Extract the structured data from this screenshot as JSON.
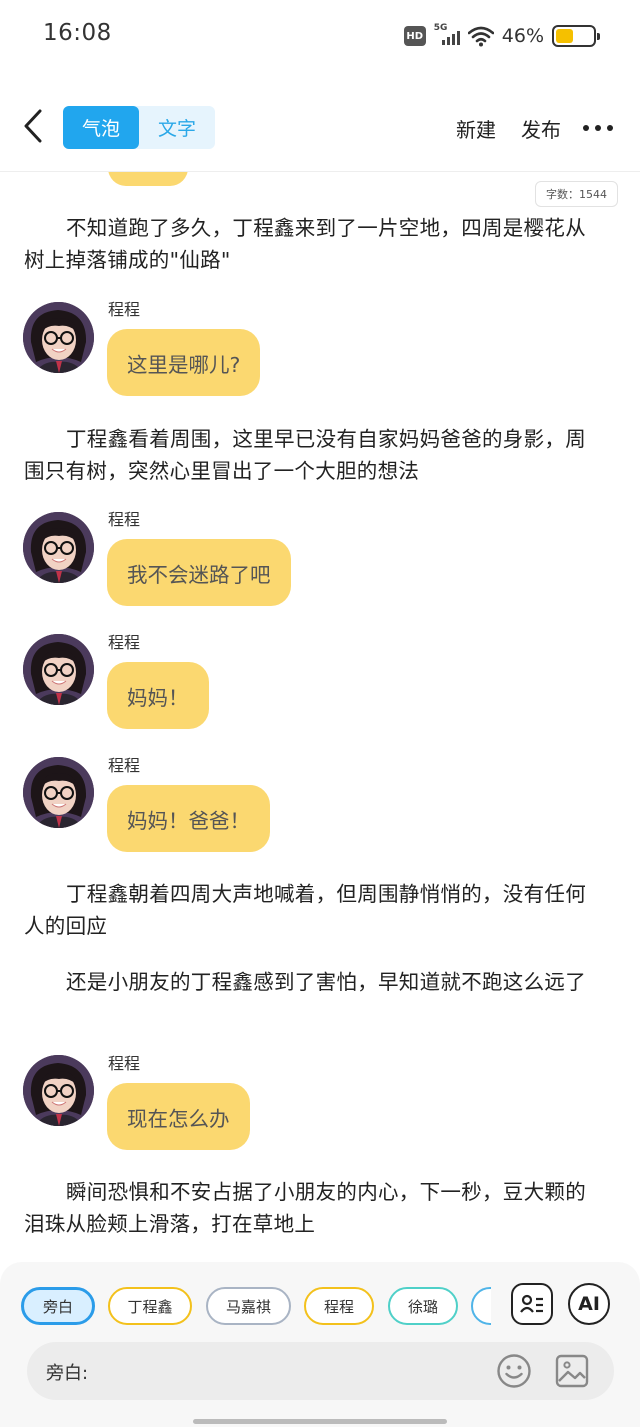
{
  "status_bar": {
    "time": "16:08",
    "hd_label": "HD",
    "network_label": "5G",
    "battery_percent": "46%",
    "battery_level": 0.46
  },
  "nav": {
    "tabs": [
      {
        "label": "气泡",
        "active": true
      },
      {
        "label": "文字",
        "active": false
      }
    ],
    "new_label": "新建",
    "publish_label": "发布"
  },
  "word_count": "字数：1544",
  "story": {
    "narration_1": "不知道跑了多久，丁程鑫来到了一片空地，四周是樱花从树上掉落铺成的\"仙路\"",
    "narration_2": "丁程鑫看着周围，这里早已没有自家妈妈爸爸的身影，周围只有树，突然心里冒出了一个大胆的想法",
    "narration_3": "丁程鑫朝着四周大声地喊着，但周围静悄悄的，没有任何人的回应",
    "narration_4": "还是小朋友的丁程鑫感到了害怕，早知道就不跑这么远了",
    "narration_5": "瞬间恐惧和不安占据了小朋友的内心，下一秒，豆大颗的泪珠从脸颊上滑落，打在草地上",
    "messages": [
      {
        "speaker": "程程",
        "text": "这里是哪儿?"
      },
      {
        "speaker": "程程",
        "text": "我不会迷路了吧"
      },
      {
        "speaker": "程程",
        "text": "妈妈！"
      },
      {
        "speaker": "程程",
        "text": "妈妈！爸爸！"
      },
      {
        "speaker": "程程",
        "text": "现在怎么办"
      }
    ]
  },
  "characters": [
    {
      "label": "旁白",
      "color": "#2b9ce9",
      "selected": true
    },
    {
      "label": "丁程鑫",
      "color": "#f3c11c",
      "selected": false
    },
    {
      "label": "马嘉祺",
      "color": "#a9b4c4",
      "selected": false
    },
    {
      "label": "程程",
      "color": "#f3c11c",
      "selected": false
    },
    {
      "label": "徐璐",
      "color": "#4fd0c8",
      "selected": false
    },
    {
      "label": "",
      "color": "#4fb4e8",
      "selected": false
    }
  ],
  "ai_label": "AI",
  "input": {
    "role_label": "旁白:",
    "value": ""
  },
  "colors": {
    "accent": "#21a6ee",
    "bubble": "#fbd870"
  }
}
